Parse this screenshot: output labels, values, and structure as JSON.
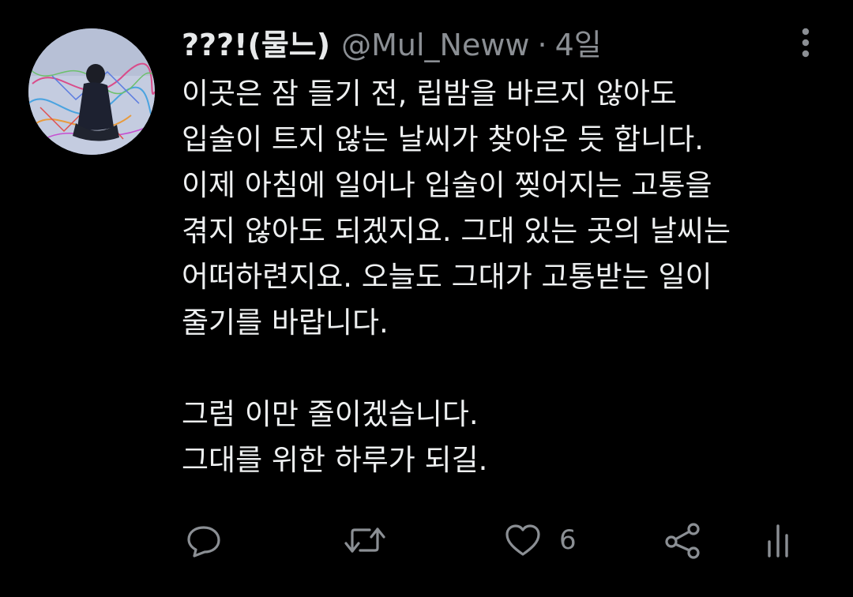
{
  "user": {
    "display_name": "???!(물느)",
    "handle": "@Mul_Neww",
    "separator": "·",
    "time": "4일"
  },
  "tweet": {
    "lines": [
      "이곳은 잠 들기 전, 립밤을 바르지 않아도",
      "입술이 트지 않는 날씨가 찾아온 듯 합니다.",
      "이제 아침에 일어나 입술이 찢어지는 고통을",
      "겪지 않아도 되겠지요. 그대 있는 곳의 날씨는",
      "어떠하련지요. 오늘도 그대가 고통받는 일이",
      "줄기를 바랍니다.",
      "",
      "그럼 이만 줄이겠습니다.",
      "그대를 위한 하루가 되길."
    ]
  },
  "actions": {
    "like_count": "6",
    "icons": [
      "reply-icon",
      "retweet-icon",
      "like-icon",
      "share-icon",
      "analytics-icon"
    ]
  },
  "colors": {
    "background": "#000000",
    "text": "#eef0f1",
    "secondary": "#8b8f94"
  }
}
